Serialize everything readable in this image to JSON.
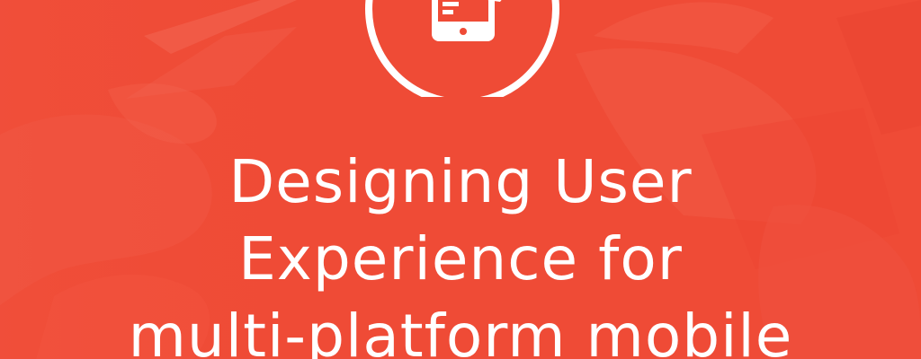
{
  "banner": {
    "headline_lines": [
      "Designing User",
      "Experience for",
      "multi-platform mobile"
    ],
    "icon": "phone-gear-icon",
    "background_color": "#ef4b36",
    "text_color": "#ffffff"
  }
}
